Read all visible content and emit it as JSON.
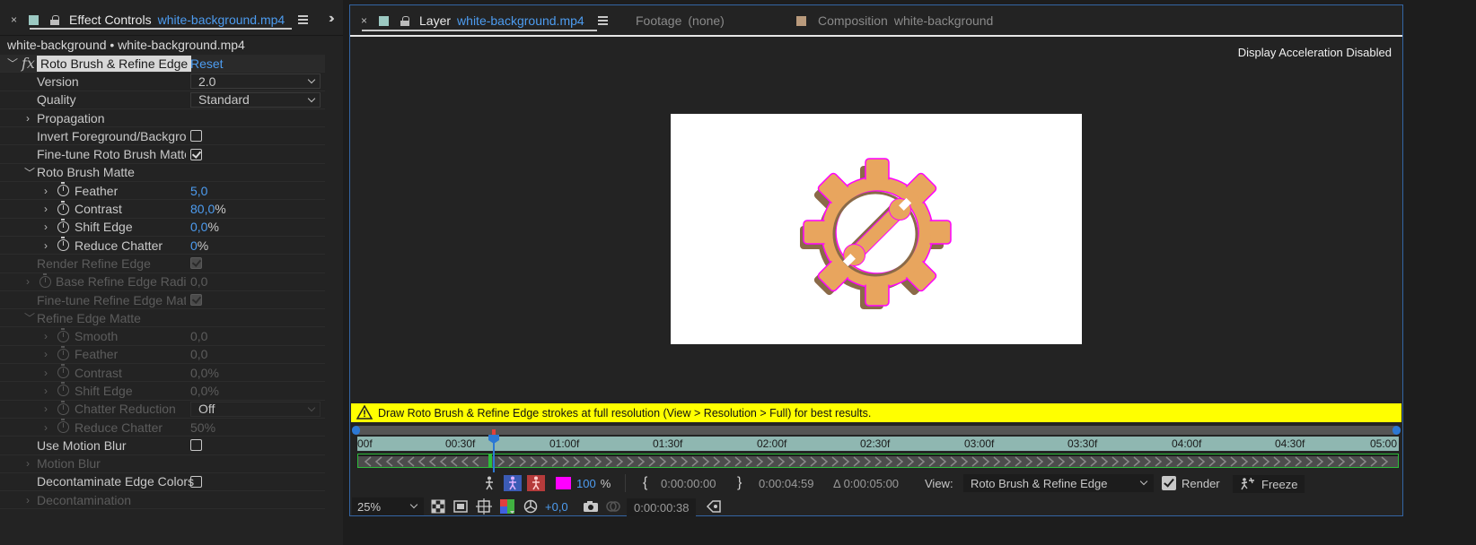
{
  "effect_controls": {
    "tab": {
      "close": "×",
      "title": "Effect Controls",
      "file": "white-background.mp4"
    },
    "subtitle": "white-background • white-background.mp4",
    "effect": {
      "name": "Roto Brush & Refine Edge",
      "reset": "Reset"
    },
    "rows": {
      "version": {
        "label": "Version",
        "value": "2.0"
      },
      "quality": {
        "label": "Quality",
        "value": "Standard"
      },
      "propagation": {
        "label": "Propagation"
      },
      "invert": {
        "label": "Invert Foreground/Backgrou"
      },
      "finetune_roto": {
        "label": "Fine-tune Roto Brush Matte"
      },
      "roto_matte": {
        "label": "Roto Brush Matte"
      },
      "feather": {
        "label": "Feather",
        "value": "5,0"
      },
      "contrast": {
        "label": "Contrast",
        "value": "80,0",
        "unit": "%"
      },
      "shift_edge": {
        "label": "Shift Edge",
        "value": "0,0",
        "unit": "%"
      },
      "reduce_chatter": {
        "label": "Reduce Chatter",
        "value": "0",
        "unit": "%"
      },
      "render_refine": {
        "label": "Render Refine Edge"
      },
      "base_radius": {
        "label": "Base Refine Edge Radius",
        "value": "0,0"
      },
      "finetune_refine": {
        "label": "Fine-tune Refine Edge Matt"
      },
      "refine_matte": {
        "label": "Refine Edge Matte"
      },
      "smooth": {
        "label": "Smooth",
        "value": "0,0"
      },
      "feather2": {
        "label": "Feather",
        "value": "0,0"
      },
      "contrast2": {
        "label": "Contrast",
        "value": "0,0",
        "unit": "%"
      },
      "shift_edge2": {
        "label": "Shift Edge",
        "value": "0,0",
        "unit": "%"
      },
      "chatter_reduction": {
        "label": "Chatter Reduction",
        "value": "Off"
      },
      "reduce_chatter2": {
        "label": "Reduce Chatter",
        "value": "50",
        "unit": "%"
      },
      "motion_blur_use": {
        "label": "Use Motion Blur"
      },
      "motion_blur": {
        "label": "Motion Blur"
      },
      "decontam_colors": {
        "label": "Decontaminate Edge Colors"
      },
      "decontamination": {
        "label": "Decontamination"
      }
    }
  },
  "layer_panel": {
    "tabs": {
      "layer": {
        "close": "×",
        "title": "Layer",
        "file": "white-background.mp4"
      },
      "footage": {
        "title": "Footage",
        "value": "(none)"
      },
      "composition": {
        "title": "Composition",
        "value": "white-background"
      }
    },
    "viewer": {
      "accel_notice": "Display Acceleration Disabled"
    },
    "warning": "Draw Roto Brush & Refine Edge strokes at full resolution (View > Resolution > Full) for best results.",
    "ruler_ticks": [
      "00f",
      "00:30f",
      "01:00f",
      "01:30f",
      "02:00f",
      "02:30f",
      "03:00f",
      "03:30f",
      "04:00f",
      "04:30f",
      "05:00"
    ],
    "controls": {
      "opacity_value": "100",
      "opacity_unit": "%",
      "in_time": "0:00:00:00",
      "out_time": "0:00:04:59",
      "duration": "Δ 0:00:05:00",
      "view_label": "View:",
      "view_value": "Roto Brush & Refine Edge",
      "render_label": "Render",
      "freeze_label": "Freeze",
      "zoom": "25%",
      "exposure": "+0,0",
      "current_time": "0:00:00:38"
    }
  },
  "colors": {
    "accent_blue": "#4d9cf0",
    "warning_yellow": "#ffff00",
    "matte_magenta": "#ff00ff",
    "gear_orange": "#e8a55e",
    "ruler_teal": "#8fb7b1"
  }
}
